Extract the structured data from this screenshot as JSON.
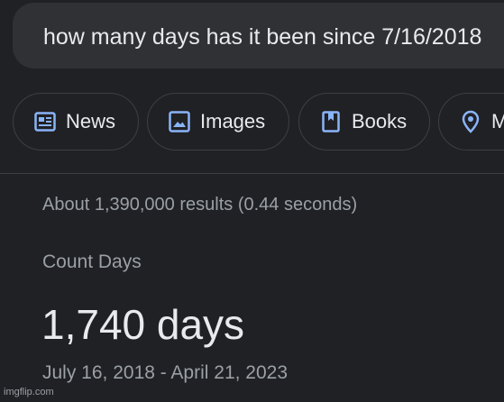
{
  "search": {
    "query": "how many days has it been since 7/16/2018"
  },
  "chips": [
    {
      "label": "News",
      "icon": "news-icon"
    },
    {
      "label": "Images",
      "icon": "image-icon"
    },
    {
      "label": "Books",
      "icon": "book-icon"
    },
    {
      "label": "M",
      "icon": "map-pin-icon"
    }
  ],
  "results": {
    "stats": "About 1,390,000 results (0.44 seconds)"
  },
  "answer": {
    "label": "Count Days",
    "value": "1,740 days",
    "range": "July 16, 2018 - April 21, 2023"
  },
  "watermark": "imgflip.com",
  "colors": {
    "background": "#202124",
    "search_box": "#303134",
    "icon_blue": "#8ab4f8",
    "text_primary": "#e8eaed",
    "text_secondary": "#9aa0a6"
  }
}
